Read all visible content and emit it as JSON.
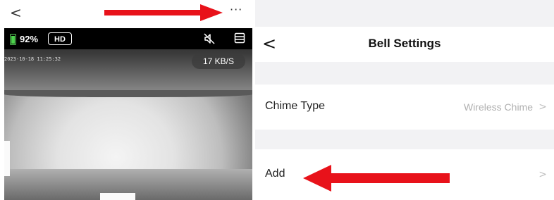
{
  "left_panel": {
    "back_glyph": "<",
    "more_glyph": "···",
    "status": {
      "battery_percent": "92%",
      "battery_color": "#4cd14c",
      "quality": "HD",
      "mute_icon": "speaker-mute-icon",
      "layout_icon": "layout-icon"
    },
    "timestamp": "2023-10-18 11:25:32",
    "speed": "17 KB/S"
  },
  "right_panel": {
    "back_glyph": "<",
    "title": "Bell Settings",
    "rows": [
      {
        "label": "Chime Type",
        "value": "Wireless Chime",
        "chevron": ">"
      },
      {
        "label": "Add",
        "value": "",
        "chevron": ">"
      }
    ]
  },
  "annotations": {
    "arrow_color": "#e8121a"
  }
}
